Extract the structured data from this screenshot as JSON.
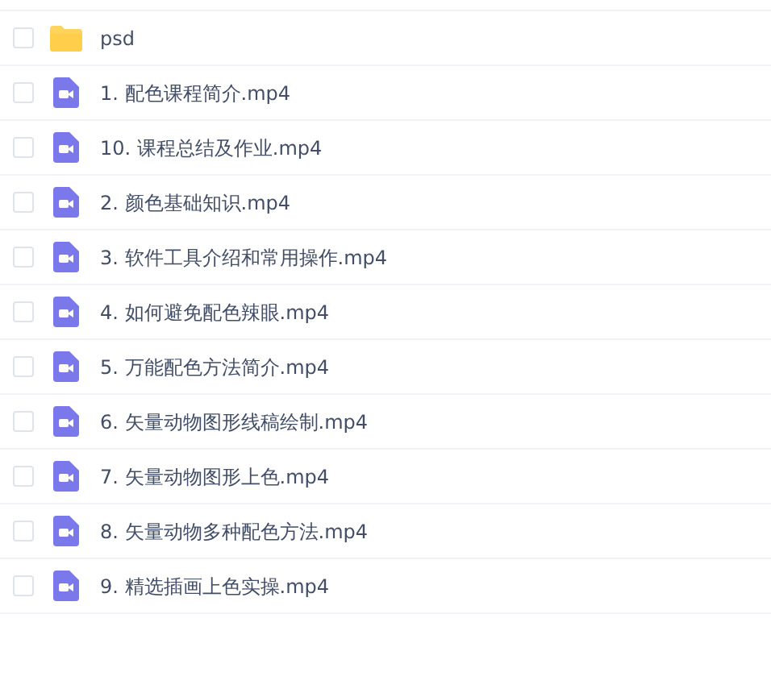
{
  "files": [
    {
      "kind": "folder",
      "name": "psd",
      "checked": false
    },
    {
      "kind": "video",
      "name": "1. 配色课程简介.mp4",
      "checked": false
    },
    {
      "kind": "video",
      "name": "10. 课程总结及作业.mp4",
      "checked": false
    },
    {
      "kind": "video",
      "name": "2. 颜色基础知识.mp4",
      "checked": false
    },
    {
      "kind": "video",
      "name": "3. 软件工具介绍和常用操作.mp4",
      "checked": false
    },
    {
      "kind": "video",
      "name": "4. 如何避免配色辣眼.mp4",
      "checked": false
    },
    {
      "kind": "video",
      "name": "5. 万能配色方法简介.mp4",
      "checked": false
    },
    {
      "kind": "video",
      "name": "6. 矢量动物图形线稿绘制.mp4",
      "checked": false
    },
    {
      "kind": "video",
      "name": "7. 矢量动物图形上色.mp4",
      "checked": false
    },
    {
      "kind": "video",
      "name": "8. 矢量动物多种配色方法.mp4",
      "checked": false
    },
    {
      "kind": "video",
      "name": "9. 精选插画上色实操.mp4",
      "checked": false
    }
  ]
}
